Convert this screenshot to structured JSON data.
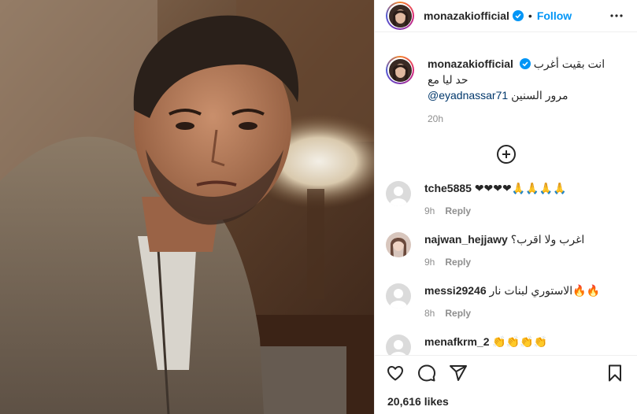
{
  "post": {
    "username": "monazakiofficial",
    "follow_label": "Follow",
    "dot": "•"
  },
  "caption": {
    "username": "monazakiofficial",
    "text_line1": "انت بقيت أغرب حد ليا مع",
    "mention": "@eyadnassar71",
    "text_line2": "مرور السنين",
    "time": "20h"
  },
  "comments": [
    {
      "user": "tche5885",
      "text": "❤❤❤❤🙏🙏🙏🙏",
      "time": "9h",
      "reply": "Reply"
    },
    {
      "user": "najwan_hejjawy",
      "text": "اغرب ولا اقرب؟",
      "time": "9h",
      "reply": "Reply"
    },
    {
      "user": "messi29246",
      "text": "الاستوري لبنات نار🔥🔥",
      "time": "8h",
      "reply": "Reply"
    },
    {
      "user": "menafkrm_2",
      "text": "👏👏👏👏",
      "time": "",
      "reply": ""
    }
  ],
  "likes": "20,616 likes",
  "colors": {
    "accent": "#0095f6",
    "muted": "#8e8e8e",
    "text": "#262626"
  }
}
